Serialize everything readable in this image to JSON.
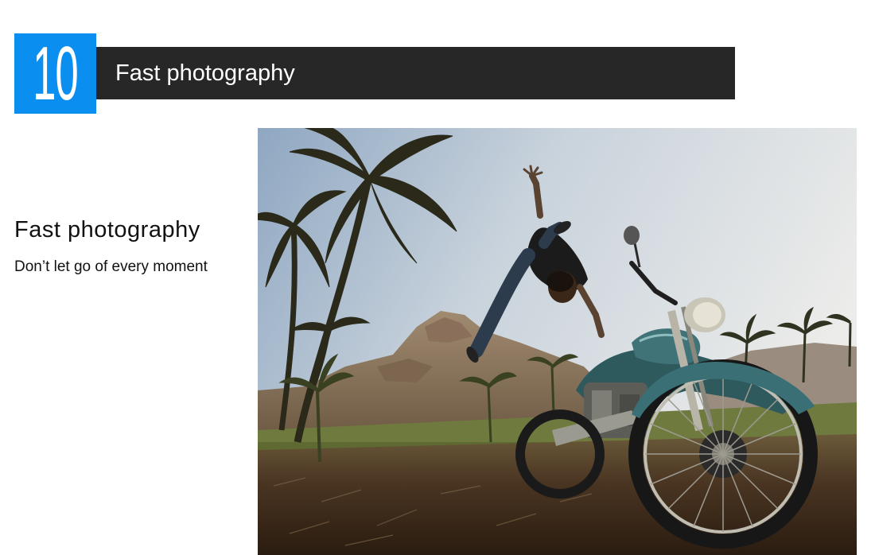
{
  "section": {
    "number": "10",
    "title": "Fast photography"
  },
  "feature": {
    "heading": "Fast photography",
    "description": "Don’t let go of every moment"
  },
  "colors": {
    "badge": "#0a8ff0",
    "title_bar": "#272727",
    "text": "#111111"
  },
  "photo": {
    "subject": "man leaping beside a teal motorcycle under palm trees"
  }
}
